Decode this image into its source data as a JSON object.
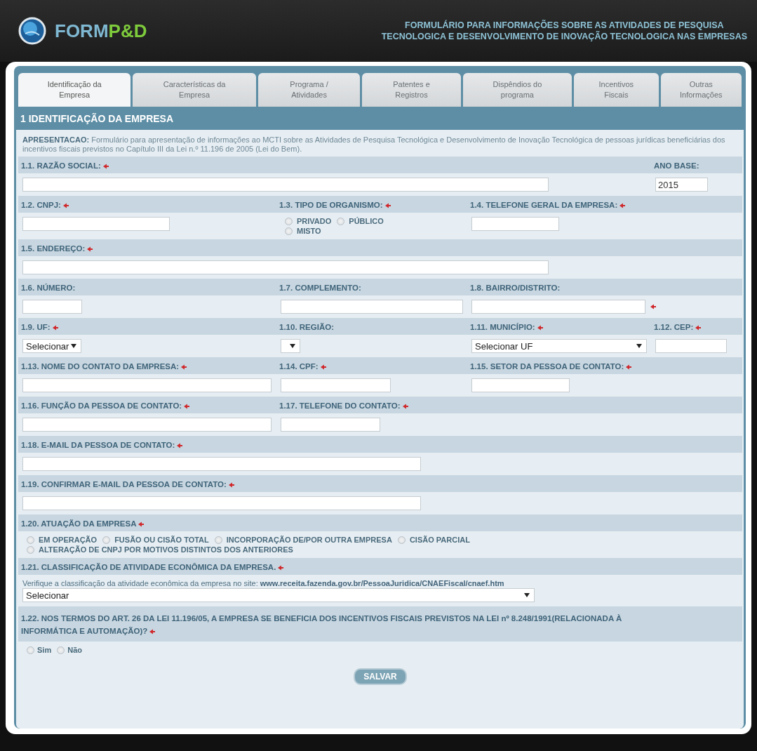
{
  "header": {
    "logo": {
      "prefix": "FORM",
      "accent": "P&D"
    },
    "title": [
      "FORMULÁRIO PARA INFORMAÇÕES SOBRE AS ATIVIDADES DE PESQUISA",
      "TECNOLOGICA E DESENVOLVIMENTO DE INOVAÇÃO TECNOLOGICA NAS EMPRESAS"
    ]
  },
  "tabs": [
    {
      "label": "Identificação da\nEmpresa",
      "selected": true
    },
    {
      "label": "Características da\nEmpresa",
      "selected": false
    },
    {
      "label": "Programa /\nAtividades",
      "selected": false
    },
    {
      "label": "Patentes e\nRegistros",
      "selected": false
    },
    {
      "label": "Dispêndios do\nprograma",
      "selected": false
    },
    {
      "label": "Incentivos\nFiscais",
      "selected": false
    },
    {
      "label": "Outras\nInformações",
      "selected": false
    }
  ],
  "section_title": "1 IDENTIFICAÇÃO DA EMPRESA",
  "intro": "**APRESENTACAO:** Formulário para apresentação de informações ao MCTI sobre as Atividades de Pesquisa Tecnológica e Desenvolvimento de Inovação Tecnológica de pessoas jurídicas beneficiárias dos incentivos fiscais previstos no Capítulo III da Lei n.º 11.196 de 2005 (Lei do Bem).",
  "rows": [
    {
      "cells": [
        {
          "label": "1.1. RAZÃO SOCIAL:",
          "required": true,
          "field": {
            "kind": "text"
          }
        },
        {
          "label": "ANO BASE:",
          "required": false,
          "field": {
            "kind": "text",
            "value": "2015"
          }
        }
      ]
    },
    {
      "cells": [
        {
          "label": "1.2. CNPJ:",
          "required": true,
          "field": {
            "kind": "text"
          }
        },
        {
          "label": "1.3. TIPO DE ORGANISMO:",
          "required": true,
          "field": {
            "kind": "radios",
            "options": [
              {
                "label": "PRIVADO",
                "selected": false
              },
              {
                "label": "PÚBLICO",
                "selected": false
              },
              {
                "label": "MISTO",
                "selected": false
              }
            ]
          }
        },
        {
          "label": "1.4. TELEFONE GERAL DA EMPRESA:",
          "required": true,
          "field": {
            "kind": "text"
          }
        }
      ]
    },
    {
      "cells": [
        {
          "label": "1.5. ENDEREÇO:",
          "required": true,
          "field": {
            "kind": "text"
          }
        }
      ]
    },
    {
      "cells": [
        {
          "label": "1.6. NÚMERO:",
          "required": false,
          "field": {
            "kind": "text"
          }
        },
        {
          "label": "1.7. COMPLEMENTO:",
          "required": false,
          "field": {
            "kind": "text"
          }
        },
        {
          "label": "1.8. BAIRRO/DISTRITO:",
          "required": false,
          "field": {
            "kind": "text",
            "required": true
          }
        }
      ]
    },
    {
      "cells": [
        {
          "label": "1.9. UF:",
          "required": true,
          "field": {
            "kind": "select",
            "value": "Selecionar"
          }
        },
        {
          "label": "1.10. REGIÃO:",
          "required": false,
          "field": {
            "kind": "select"
          }
        },
        {
          "label": "1.11. MUNICÍPIO:",
          "required": true,
          "field": {
            "kind": "select",
            "value": "Selecionar UF"
          }
        },
        {
          "label": "1.12. CEP:",
          "required": true,
          "field": {
            "kind": "text"
          }
        }
      ]
    },
    {
      "cells": [
        {
          "label": "1.13. NOME DO CONTATO DA EMPRESA:",
          "required": true,
          "field": {
            "kind": "text"
          }
        },
        {
          "label": "1.14. CPF:",
          "required": true,
          "field": {
            "kind": "text"
          }
        },
        {
          "label": "1.15. SETOR DA PESSOA DE CONTATO:",
          "required": true,
          "field": {
            "kind": "text"
          }
        }
      ]
    },
    {
      "cells": [
        {
          "label": "1.16. FUNÇÃO DA PESSOA DE CONTATO:",
          "required": true,
          "field": {
            "kind": "text"
          }
        },
        {
          "label": "1.17. TELEFONE DO CONTATO:",
          "required": true,
          "field": {
            "kind": "text"
          }
        }
      ]
    },
    {
      "cells": [
        {
          "label": "1.18. E-MAIL DA PESSOA DE CONTATO:",
          "required": true,
          "field": {
            "kind": "text"
          }
        }
      ]
    },
    {
      "cells": [
        {
          "label": "1.19. CONFIRMAR E-MAIL DA PESSOA DE CONTATO:",
          "required": true,
          "field": {
            "kind": "text"
          }
        }
      ]
    },
    {
      "cells": [
        {
          "label": "1.20. ATUAÇÃO DA EMPRESA",
          "required": true,
          "field": {
            "kind": "radios",
            "options": [
              {
                "label": "EM OPERAÇÃO",
                "selected": false
              },
              {
                "label": "FUSÃO OU CISÃO TOTAL",
                "selected": false
              },
              {
                "label": "INCORPORAÇÃO DE/POR OUTRA EMPRESA",
                "selected": false
              },
              {
                "label": "CISÃO PARCIAL",
                "selected": false
              },
              {
                "label": "ALTERAÇÃO DE CNPJ POR MOTIVOS DISTINTOS DOS ANTERIORES",
                "selected": false
              }
            ]
          }
        }
      ]
    },
    {
      "cells": [
        {
          "label": "1.21. CLASSIFICAÇÃO DE ATIVIDADE ECONÔMICA DA EMPRESA.",
          "required": true,
          "field": {
            "kind": "select",
            "note": "Verifique a classificação da atividade econômica da empresa no site: **www.receita.fazenda.gov.br/PessoaJuridica/CNAEFiscal/cnaef.htm**",
            "value": "Selecionar"
          }
        }
      ]
    },
    {
      "cells": [
        {
          "label": "1.22. NOS TERMOS DO ART. 26 DA LEI 11.196/05, A EMPRESA SE BENEFICIA DOS INCENTIVOS FISCAIS PREVISTOS NA LEI nº 8.248/1991(RELACIONADA À INFORMÁTICA E AUTOMAÇÃO)?",
          "required": true,
          "field": {
            "kind": "radios",
            "options": [
              {
                "label": "Sim",
                "selected": false
              },
              {
                "label": "Não",
                "selected": false
              }
            ]
          }
        }
      ]
    }
  ],
  "save_button": "SALVAR"
}
